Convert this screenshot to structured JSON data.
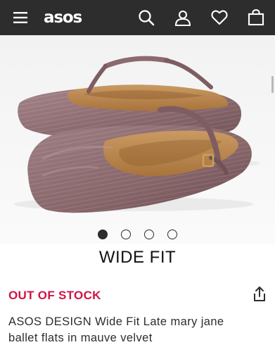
{
  "header": {
    "logo_text": "asos",
    "icons": [
      "hamburger-menu-icon",
      "search-icon",
      "account-icon",
      "heart-icon",
      "bag-icon"
    ],
    "background": "#2d2d2d"
  },
  "gallery": {
    "image_count": 4,
    "active_index": 0,
    "image_alt": "Mauve crushed-velvet mary jane ballet flats"
  },
  "banner": {
    "text": "WIDE FIT"
  },
  "product": {
    "stock_status": "OUT OF STOCK",
    "title": "ASOS DESIGN Wide Fit Late mary jane ballet flats in mauve velvet",
    "share_icon": "share-icon"
  },
  "colors": {
    "out_of_stock": "#d01345",
    "velvet": "#8a6a6e",
    "lining": "#c08a52"
  }
}
